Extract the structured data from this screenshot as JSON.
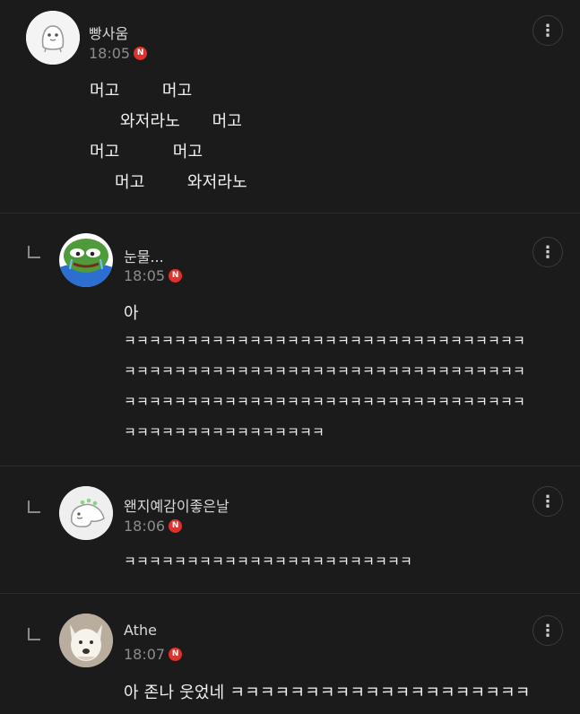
{
  "comments": [
    {
      "author": "빵사움",
      "time": "18:05",
      "badge": "N",
      "avatar_icon": "white-blob-character-icon",
      "more_icon": "⋮",
      "lines": [
        "머고        머고",
        "와저라노      머고",
        "머고          머고",
        "머고        와저라노"
      ]
    },
    {
      "author": "눈물...",
      "time": "18:05",
      "badge": "N",
      "avatar_icon": "pepe-frog-icon",
      "more_icon": "⋮",
      "lines": [
        "아",
        "ㅋㅋㅋㅋㅋㅋㅋㅋㅋㅋㅋㅋㅋㅋㅋㅋㅋㅋㅋㅋㅋㅋㅋㅋㅋㅋㅋㅋㅋㅋㅋㅋ",
        "ㅋㅋㅋㅋㅋㅋㅋㅋㅋㅋㅋㅋㅋㅋㅋㅋㅋㅋㅋㅋㅋㅋㅋㅋㅋㅋㅋㅋㅋㅋㅋㅋ",
        "ㅋㅋㅋㅋㅋㅋㅋㅋㅋㅋㅋㅋㅋㅋㅋㅋㅋㅋㅋㅋㅋㅋㅋㅋㅋㅋㅋㅋㅋㅋㅋㅋ",
        "ㅋㅋㅋㅋㅋㅋㅋㅋㅋㅋㅋㅋㅋㅋㅋㅋ"
      ]
    },
    {
      "author": "왠지예감이좋은날",
      "time": "18:06",
      "badge": "N",
      "avatar_icon": "white-dinosaur-icon",
      "more_icon": "⋮",
      "lines": [
        "ㅋㅋㅋㅋㅋㅋㅋㅋㅋㅋㅋㅋㅋㅋㅋㅋㅋㅋㅋㅋㅋㅋㅋ"
      ]
    },
    {
      "author": "Athe",
      "time": "18:07",
      "badge": "N",
      "avatar_icon": "white-dog-photo-icon",
      "more_icon": "⋮",
      "lines": [
        "아 존나 웃었네 ㅋㅋㅋㅋㅋㅋㅋㅋㅋㅋㅋㅋㅋㅋㅋㅋㅋㅋㅋㅋ"
      ]
    }
  ]
}
